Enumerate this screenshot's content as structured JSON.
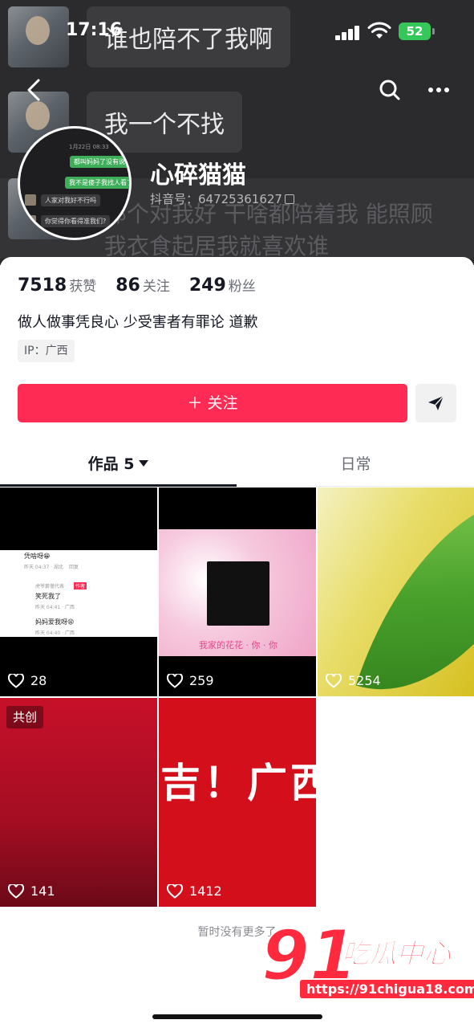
{
  "status_bar": {
    "time": "17:16",
    "battery": "52"
  },
  "background": {
    "bubbles": [
      "谁也陪不了我啊",
      "我一个不找"
    ],
    "faint_text_1": "那个对我好 干啥都陪着我 能照顾",
    "faint_text_2": "我衣食起居我就喜欢谁"
  },
  "avatar": {
    "lines": [
      "都叫妈妈了没有说吗",
      "我不是傻子我找人看了",
      "人家对我好不行吗",
      "你觉得你看得准我们?"
    ],
    "date": "1月22日 08:33"
  },
  "profile": {
    "nickname": "心碎猫猫",
    "douyin_id": "抖音号：64725361627"
  },
  "stats": [
    {
      "value": "7518",
      "label": "获赞"
    },
    {
      "value": "86",
      "label": "关注"
    },
    {
      "value": "249",
      "label": "粉丝"
    }
  ],
  "bio": "做人做事凭良心 少受害者有罪论 道歉",
  "ip": "IP：广西",
  "follow_label": "＋ 关注",
  "tabs": {
    "works": "作品 5",
    "daily": "日常"
  },
  "videos": [
    {
      "likes": "28"
    },
    {
      "likes": "259"
    },
    {
      "likes": "5254"
    },
    {
      "likes": "141",
      "tag": "共创"
    },
    {
      "likes": "1412"
    }
  ],
  "video1_comments": [
    "凭啥呀😁",
    "昨天 04:37 · 湖北",
    "虎爷爵億代表",
    "作者",
    "笑死我了",
    "昨天 04:41 · 广西",
    "妈妈爱我呀😫",
    "昨天 04:40 · 广西",
    "回复"
  ],
  "video2_caption": "我家的花花 · 你 · 你",
  "video5_text": "吉！广西村",
  "no_more": "暂时没有更多了",
  "watermark": {
    "brand": "91",
    "name": "吃瓜中心",
    "url": "https://91chigua18.com"
  },
  "colors": {
    "accent": "#fe2c55",
    "header_bg": "#2b2b2d"
  }
}
